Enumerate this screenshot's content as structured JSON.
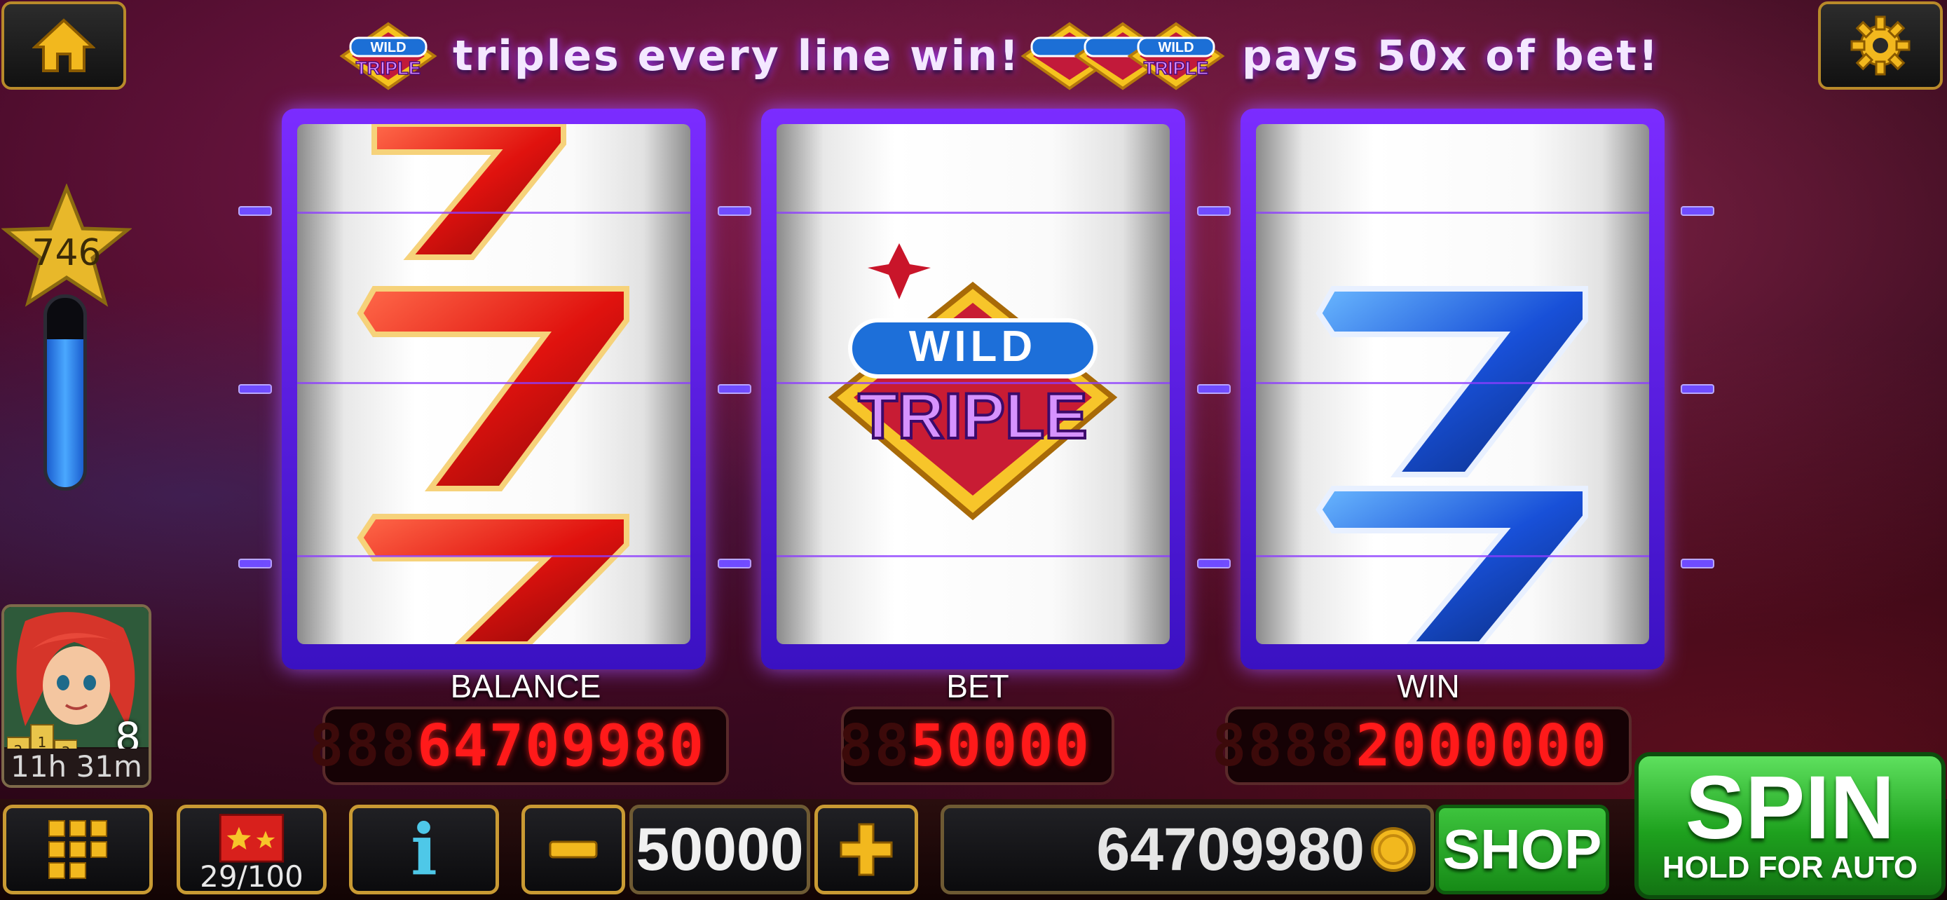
{
  "top_banner": {
    "left_text": "triples every line win!",
    "right_text": "pays 50x of bet!",
    "logo_word_top": "WILD",
    "logo_word_bottom": "TRIPLE"
  },
  "player": {
    "level": "746",
    "level_progress": 0.78,
    "avatar_badge_number": "8",
    "podium_ranks": [
      "2",
      "1",
      "3"
    ],
    "timer": "11h 31m"
  },
  "reels": [
    {
      "symbol": "red-double-seven-icon"
    },
    {
      "symbol": "wild-triple-logo",
      "top": "WILD",
      "bottom": "TRIPLE"
    },
    {
      "symbol": "blue-double-seven-icon"
    }
  ],
  "displays": {
    "balance_label": "BALANCE",
    "balance_ghost": "888",
    "balance_value": "64709980",
    "bet_label": "BET",
    "bet_ghost": "88",
    "bet_value": "50000",
    "win_label": "WIN",
    "win_ghost": "8888",
    "win_value": "2000000"
  },
  "bottom_bar": {
    "menu_icon": "grid-icon",
    "gift_progress": "29/100",
    "info_icon": "info-icon",
    "minus_icon": "minus-icon",
    "bet_amount": "50000",
    "plus_icon": "plus-icon",
    "balance": "64709980",
    "coin_icon": "coin-icon",
    "shop_label": "SHOP",
    "spin_label": "SPIN",
    "spin_sub": "HOLD FOR AUTO"
  },
  "colors": {
    "reel_frame": "#6a28ff",
    "led_red": "#ff1a1a",
    "spin_green": "#1ea11e",
    "gold_border": "#c99a33"
  }
}
